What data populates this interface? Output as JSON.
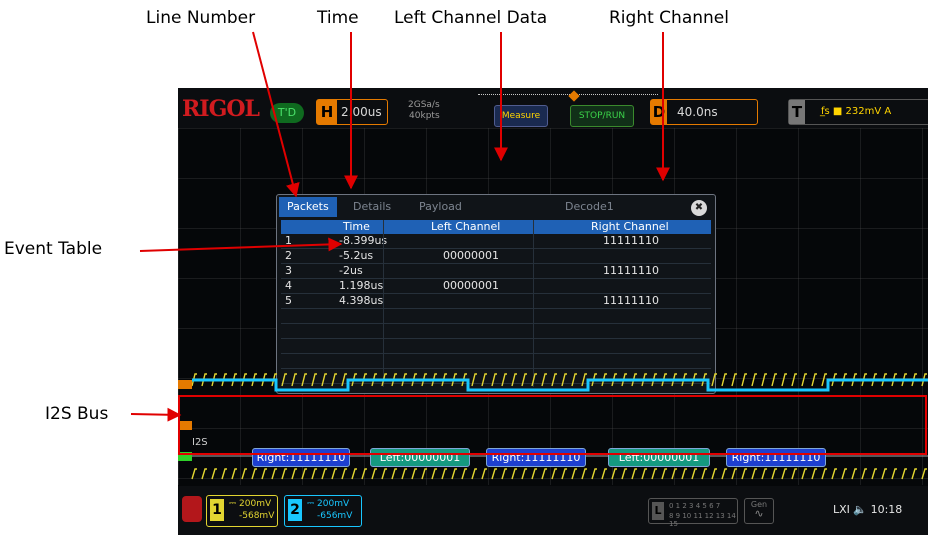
{
  "annotations": {
    "line_number": "Line Number",
    "time": "Time",
    "left_channel_data": "Left Channel Data",
    "right_channel": "Right Channel",
    "event_table": "Event  Table",
    "i2s_bus": "I2S  Bus"
  },
  "topbar": {
    "logo": "RIGOL",
    "trigger_status": "T'D",
    "h_label": "H",
    "timebase": "2.00us",
    "sample_rate": "2GSa/s",
    "memory_depth": "40kpts",
    "measure_label": "Measure",
    "stop_run_label": "STOP/RUN",
    "d_label": "D",
    "delay": "40.0ns",
    "t_label": "T",
    "trigger_info": "f̲s  ■ 232mV  A"
  },
  "event_table": {
    "tabs": [
      "Packets",
      "Details",
      "Payload",
      "Decode1"
    ],
    "close_icon_glyph": "✖",
    "columns": [
      "",
      "Time",
      "Left Channel",
      "Right Channel"
    ],
    "rows": [
      {
        "no": "1",
        "time": "-8.399us",
        "left": "",
        "right": "11111110"
      },
      {
        "no": "2",
        "time": "-5.2us",
        "left": "00000001",
        "right": ""
      },
      {
        "no": "3",
        "time": "-2us",
        "left": "",
        "right": "11111110"
      },
      {
        "no": "4",
        "time": "1.198us",
        "left": "00000001",
        "right": ""
      },
      {
        "no": "5",
        "time": "4.398us",
        "left": "",
        "right": "11111110"
      }
    ]
  },
  "bus": {
    "label": "I2S",
    "frames": [
      {
        "text": "Right:11111110",
        "kind": "right"
      },
      {
        "text": "Left:00000001",
        "kind": "left"
      },
      {
        "text": "Right:11111110",
        "kind": "right"
      },
      {
        "text": "Left:00000001",
        "kind": "left"
      },
      {
        "text": "Right:11111110",
        "kind": "right"
      }
    ]
  },
  "bottombar": {
    "ch1_number": "1",
    "ch1_scale": "⎓ 200mV",
    "ch1_offset": "-568mV",
    "ch2_number": "2",
    "ch2_scale": "⎓ 200mV",
    "ch2_offset": "-656mV",
    "logic_label": "L",
    "logic_channels_1": "0 1 2 3  4 5 6 7",
    "logic_channels_2": "8 9 10 11  12 13 14 15",
    "gen_label": "Gen",
    "system_info": "LXI 🔈 10:18"
  },
  "colors": {
    "ch1": "#e2d531",
    "ch2": "#19c7ff",
    "rigol_red": "#d11b1f",
    "annotation_red": "#e00000"
  }
}
